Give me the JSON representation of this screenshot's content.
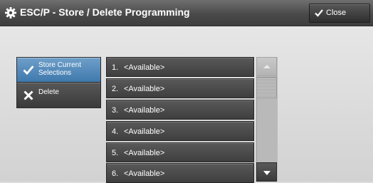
{
  "header": {
    "title": "ESC/P - Store / Delete Programming",
    "icon": "gear-icon",
    "close_label": "Close",
    "close_icon": "checkmark-icon"
  },
  "actions": {
    "store_label_line1": "Store Current",
    "store_label_line2": "Selections",
    "store_icon": "checkmark-icon",
    "delete_label": "Delete",
    "delete_icon": "x-icon"
  },
  "programs": [
    {
      "num": "1.",
      "label": "<Available>"
    },
    {
      "num": "2.",
      "label": "<Available>"
    },
    {
      "num": "3.",
      "label": "<Available>"
    },
    {
      "num": "4.",
      "label": "<Available>"
    },
    {
      "num": "5.",
      "label": "<Available>"
    },
    {
      "num": "6.",
      "label": "<Available>"
    }
  ],
  "scrollbar": {
    "up_icon": "scroll-up-icon",
    "down_icon": "scroll-down-icon"
  },
  "colors": {
    "selected": "#4f86b8",
    "button": "#474747",
    "header": "#4a4a4a",
    "background": "#dcdcdc"
  }
}
